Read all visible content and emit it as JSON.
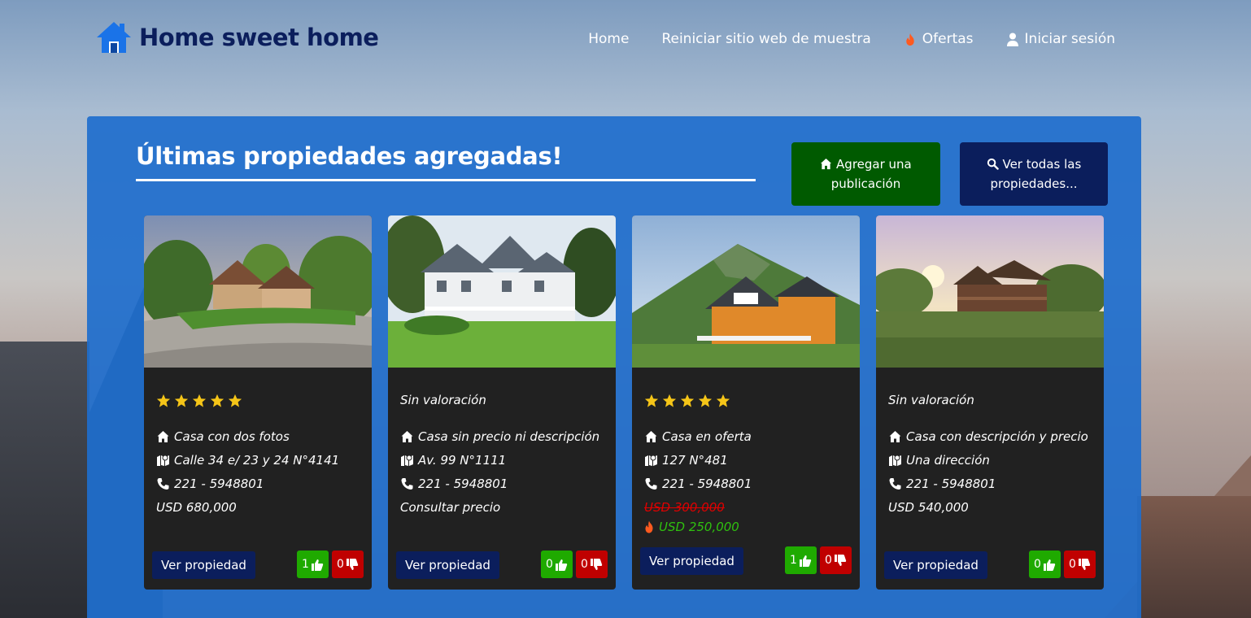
{
  "header": {
    "logo_text": "Home sweet home",
    "nav": {
      "home": "Home",
      "reset": "Reiniciar sitio web de muestra",
      "offers": "Ofertas",
      "login": "Iniciar sesión"
    }
  },
  "panel": {
    "title": "Últimas propiedades agregadas!",
    "add_button_line1": "Agregar una",
    "add_button_line2": "publicación",
    "all_button_line1": "Ver todas las",
    "all_button_line2": "propiedades..."
  },
  "cards": [
    {
      "rating": 5,
      "name": "Casa con dos fotos",
      "address": "Calle 34 e/ 23 y 24 N°4141",
      "phone": "221 - 5948801",
      "price": "USD 680,000",
      "view_label": "Ver propiedad",
      "likes": "1",
      "dislikes": "0"
    },
    {
      "rating_text": "Sin valoración",
      "name": "Casa sin precio ni descripción",
      "address": "Av. 99 N°1111",
      "phone": "221 - 5948801",
      "price": "Consultar precio",
      "view_label": "Ver propiedad",
      "likes": "0",
      "dislikes": "0"
    },
    {
      "rating": 5,
      "name": "Casa en oferta",
      "address": "127 N°481",
      "phone": "221 - 5948801",
      "old_price": "USD 300,000",
      "offer_price": "USD 250,000",
      "view_label": "Ver propiedad",
      "likes": "1",
      "dislikes": "0"
    },
    {
      "rating_text": "Sin valoración",
      "name": "Casa con descripción y precio",
      "address": "Una dirección",
      "phone": "221 - 5948801",
      "price": "USD 540,000",
      "view_label": "Ver propiedad",
      "likes": "0",
      "dislikes": "0"
    }
  ],
  "colors": {
    "brand_navy": "#0b1e5c",
    "panel_blue": "#1e6ecd",
    "add_green": "#005a00",
    "like_green": "#1faa00",
    "dislike_red": "#c00000",
    "star_yellow": "#f5c518",
    "offer_flame": "#ff5a1f"
  }
}
